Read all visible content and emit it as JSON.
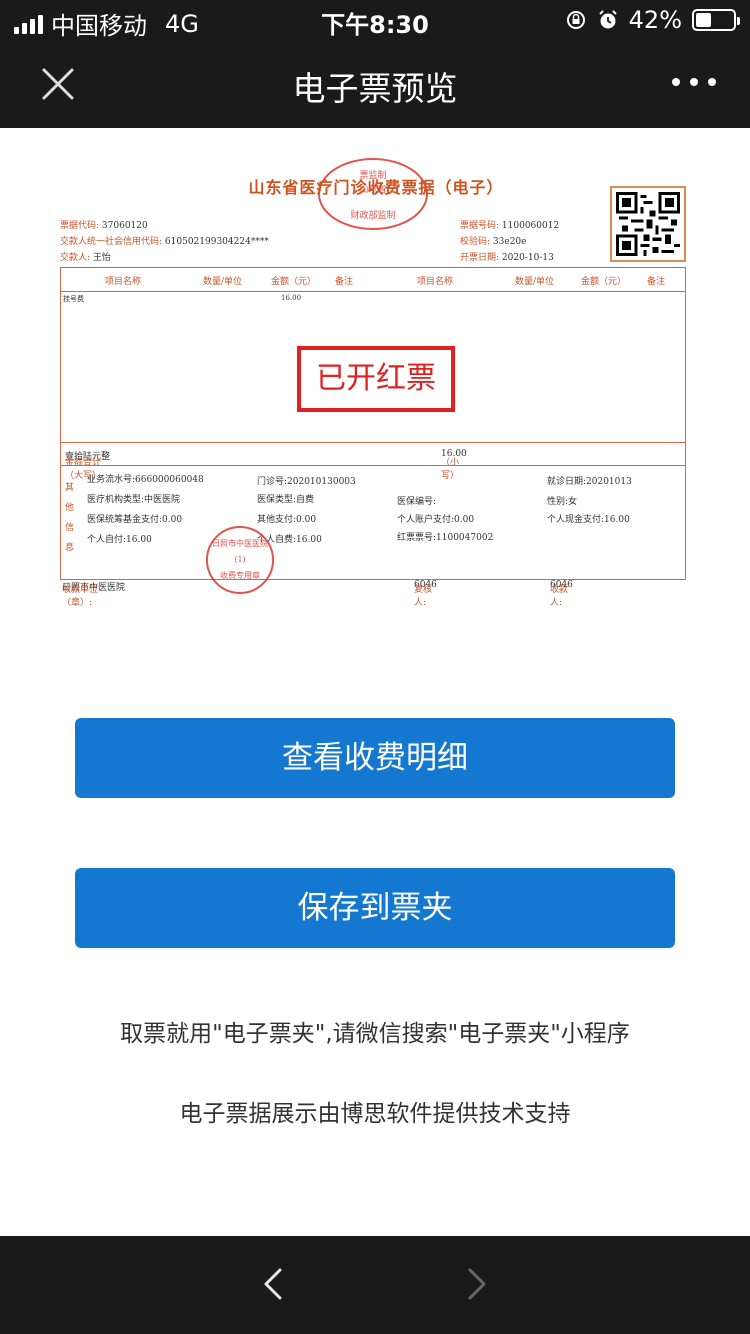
{
  "status": {
    "carrier": "中国移动",
    "network": "4G",
    "time": "下午8:30",
    "battery": "42%",
    "battery_level": 0.42
  },
  "nav": {
    "title": "电子票预览"
  },
  "receipt": {
    "title": "山东省医疗门诊收费票据（电子）",
    "seal_top": {
      "line1": "票监制",
      "line2": "山东省",
      "line3": "财政部监制"
    },
    "bill_code_label": "票据代码:",
    "bill_code": "37060120",
    "payer_credit_label": "交款人统一社会信用代码:",
    "payer_credit": "610502199304224****",
    "payer_label": "交款人:",
    "payer": "王怡",
    "bill_no_label": "票据号码:",
    "bill_no": "1100060012",
    "check_code_label": "校验码:",
    "check_code": "33e20e",
    "issue_date_label": "开票日期:",
    "issue_date": "2020-10-13",
    "headers": [
      "项目名称",
      "数量/单位",
      "金额（元）",
      "备注",
      "项目名称",
      "数量/单位",
      "金额（元）",
      "备注"
    ],
    "item_name": "挂号费",
    "item_amount": "16.00",
    "red_stamp": "已开红票",
    "total_upper_label": "金额合计（大写）",
    "total_upper": "壹拾陆元整",
    "total_lower_label": "（小写）",
    "total_lower": "16.00",
    "other_label": "其他信息",
    "fields": {
      "serial": "业务流水号:666000060048",
      "clinic_no": "门诊号:202010130003",
      "visit_date": "就诊日期:20201013",
      "org_type": "医疗机构类型:中医医院",
      "insurance_type": "医保类型:自费",
      "insurance_no": "医保编号:",
      "gender": "性别:女",
      "fund_pay": "医保统筹基金支付:0.00",
      "other_pay": "其他支付:0.00",
      "account_pay": "个人账户支付:0.00",
      "cash_pay": "个人现金支付:16.00",
      "self_pay": "个人自付:16.00",
      "self_fee": "个人自费:16.00",
      "red_bill_no": "红票票号:1100047002"
    },
    "seal_bottom": {
      "line1": "日照市中医医院",
      "line2": "(1)",
      "line3": "收费专用章"
    },
    "payee_unit_label": "收款单位（章）:",
    "payee_unit": "日照市中医医院",
    "reviewer_label": "复核人:",
    "reviewer": "6046",
    "payee_label": "收款人:",
    "payee": "6046"
  },
  "buttons": {
    "details": "查看收费明细",
    "save": "保存到票夹"
  },
  "notes": {
    "line1": "取票就用\"电子票夹\",请微信搜索\"电子票夹\"小程序",
    "line2": "电子票据展示由博思软件提供技术支持"
  },
  "colors": {
    "bar": "#1a1a1a",
    "accent": "#1578d0",
    "stamp_red": "#e0211f"
  }
}
